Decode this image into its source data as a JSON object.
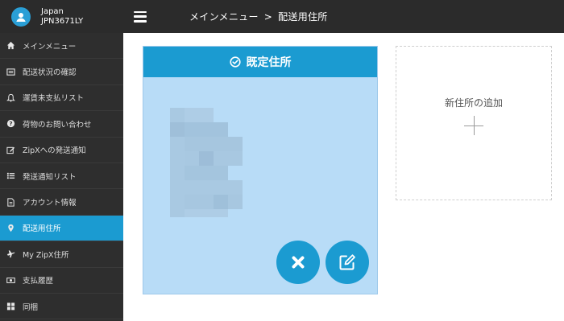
{
  "profile": {
    "country": "Japan",
    "id": "JPN3671LY"
  },
  "header": {
    "crumb_root": "メインメニュー",
    "separator": ">",
    "crumb_current": "配送用住所"
  },
  "sidebar": {
    "items": [
      {
        "label": "メインメニュー",
        "icon": "home-icon"
      },
      {
        "label": "配送状況の確認",
        "icon": "list-box-icon"
      },
      {
        "label": "運賃未支払リスト",
        "icon": "bell-icon"
      },
      {
        "label": "荷物のお問い合わせ",
        "icon": "question-circle-icon"
      },
      {
        "label": "ZipXへの発送通知",
        "icon": "edit-icon"
      },
      {
        "label": "発送通知リスト",
        "icon": "list-icon"
      },
      {
        "label": "アカウント情報",
        "icon": "document-icon"
      },
      {
        "label": "配送用住所",
        "icon": "map-pin-icon",
        "active": true
      },
      {
        "label": "My ZipX住所",
        "icon": "plane-icon"
      },
      {
        "label": "支払履歴",
        "icon": "money-icon"
      },
      {
        "label": "同梱",
        "icon": "grid-icon"
      }
    ]
  },
  "default_address": {
    "title": "既定住所"
  },
  "new_address": {
    "label": "新住所の追加"
  },
  "colors": {
    "accent": "#1b9bd1",
    "card_bg": "#b8dcf7",
    "sidebar_bg": "#2e2e2e"
  }
}
